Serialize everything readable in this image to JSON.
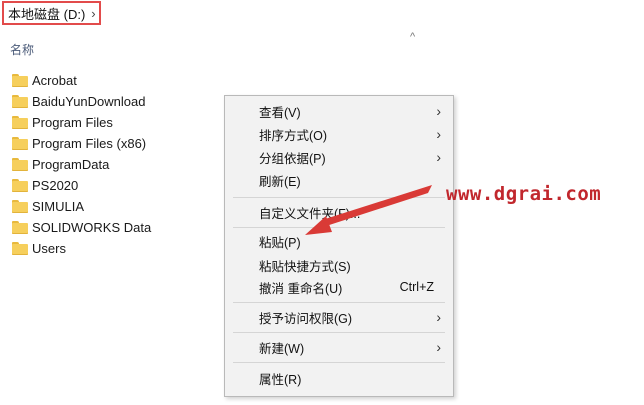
{
  "breadcrumb": {
    "location": "本地磁盘 (D:)",
    "sep": "›"
  },
  "list_header": {
    "name_column": "名称",
    "sort_icon": "^"
  },
  "files": [
    {
      "name": "Acrobat"
    },
    {
      "name": "BaiduYunDownload"
    },
    {
      "name": "Program Files"
    },
    {
      "name": "Program Files (x86)"
    },
    {
      "name": "ProgramData"
    },
    {
      "name": "PS2020"
    },
    {
      "name": "SIMULIA"
    },
    {
      "name": "SOLIDWORKS Data"
    },
    {
      "name": "Users"
    }
  ],
  "context_menu": {
    "view": "查看(V)",
    "sort_by": "排序方式(O)",
    "group_by": "分组依据(P)",
    "refresh": "刷新(E)",
    "customize_folder": "自定义文件夹(F)...",
    "paste": "粘贴(P)",
    "paste_shortcut": "粘贴快捷方式(S)",
    "undo_rename": "撤消 重命名(U)",
    "undo_shortcut": "Ctrl+Z",
    "grant_access": "授予访问权限(G)",
    "new": "新建(W)",
    "properties": "属性(R)",
    "submenu_chevron": "›"
  },
  "watermark": "www.dgrai.com",
  "colors": {
    "annotation_red": "#c1272d",
    "breadcrumb_border": "#e24b4b",
    "folder": "#f6cf5c"
  }
}
